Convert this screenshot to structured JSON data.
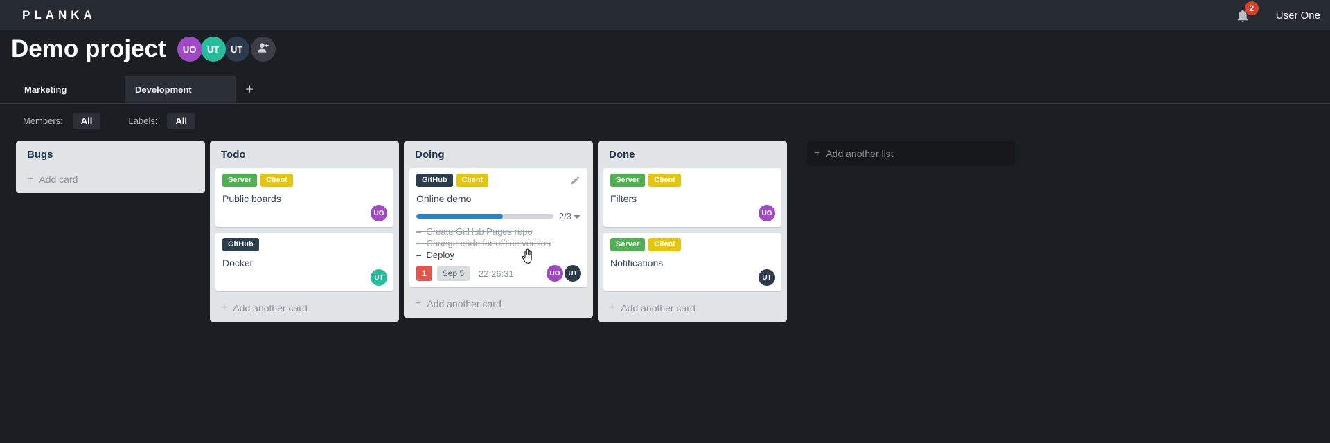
{
  "topbar": {
    "logo": "PLANKA",
    "notification_count": "2",
    "user_name": "User One"
  },
  "project": {
    "title": "Demo project",
    "members": [
      {
        "initials": "UO",
        "color": "#a149c4"
      },
      {
        "initials": "UT",
        "color": "#25bd9b"
      },
      {
        "initials": "UT",
        "color": "#2c3a4c"
      }
    ]
  },
  "tabs": [
    {
      "label": "Marketing",
      "active": false
    },
    {
      "label": "Development",
      "active": true
    }
  ],
  "filters": {
    "members_label": "Members:",
    "members_value": "All",
    "labels_label": "Labels:",
    "labels_value": "All"
  },
  "board": {
    "lists": [
      {
        "title": "Bugs",
        "add_label": "Add card",
        "cards": []
      },
      {
        "title": "Todo",
        "add_label": "Add another card",
        "cards": [
          {
            "labels": [
              "Server",
              "Client"
            ],
            "name": "Public boards",
            "members": [
              "UO"
            ]
          },
          {
            "labels": [
              "GitHub"
            ],
            "name": "Docker",
            "members": [
              "UT"
            ]
          }
        ]
      },
      {
        "title": "Doing",
        "add_label": "Add another card",
        "cards": [
          {
            "labels": [
              "GitHub",
              "Client"
            ],
            "name": "Online demo",
            "progress": {
              "label": "2/3",
              "completed": 2,
              "total": 3,
              "percent": 63
            },
            "tasks": [
              {
                "text": "Create GitHub Pages repo",
                "done": true
              },
              {
                "text": "Change code for offline version",
                "done": true
              },
              {
                "text": "Deploy",
                "done": false
              }
            ],
            "badges": {
              "notifications": "1",
              "due_date": "Sep 5",
              "stopwatch": "22:26:31"
            },
            "members": [
              "UO",
              "UT"
            ]
          }
        ]
      },
      {
        "title": "Done",
        "add_label": "Add another card",
        "cards": [
          {
            "labels": [
              "Server",
              "Client"
            ],
            "name": "Filters",
            "members": [
              "UO"
            ]
          },
          {
            "labels": [
              "Server",
              "Client"
            ],
            "name": "Notifications",
            "members": [
              "UT"
            ]
          }
        ]
      }
    ],
    "add_list_label": "Add another list"
  },
  "colors": {
    "label_server": "#4fb052",
    "label_client": "#e6c60d",
    "label_github": "#2b3e50",
    "avatar_purple": "#a149c4",
    "avatar_teal": "#25bd9b",
    "avatar_navy": "#2c3a4c",
    "badge_red": "#e3544a",
    "badge_notification": "#d9402c",
    "progress_blue": "#2383d6",
    "topbar_bg": "#262a31",
    "page_bg": "#1b1e23",
    "list_bg": "#e0e4e7"
  }
}
